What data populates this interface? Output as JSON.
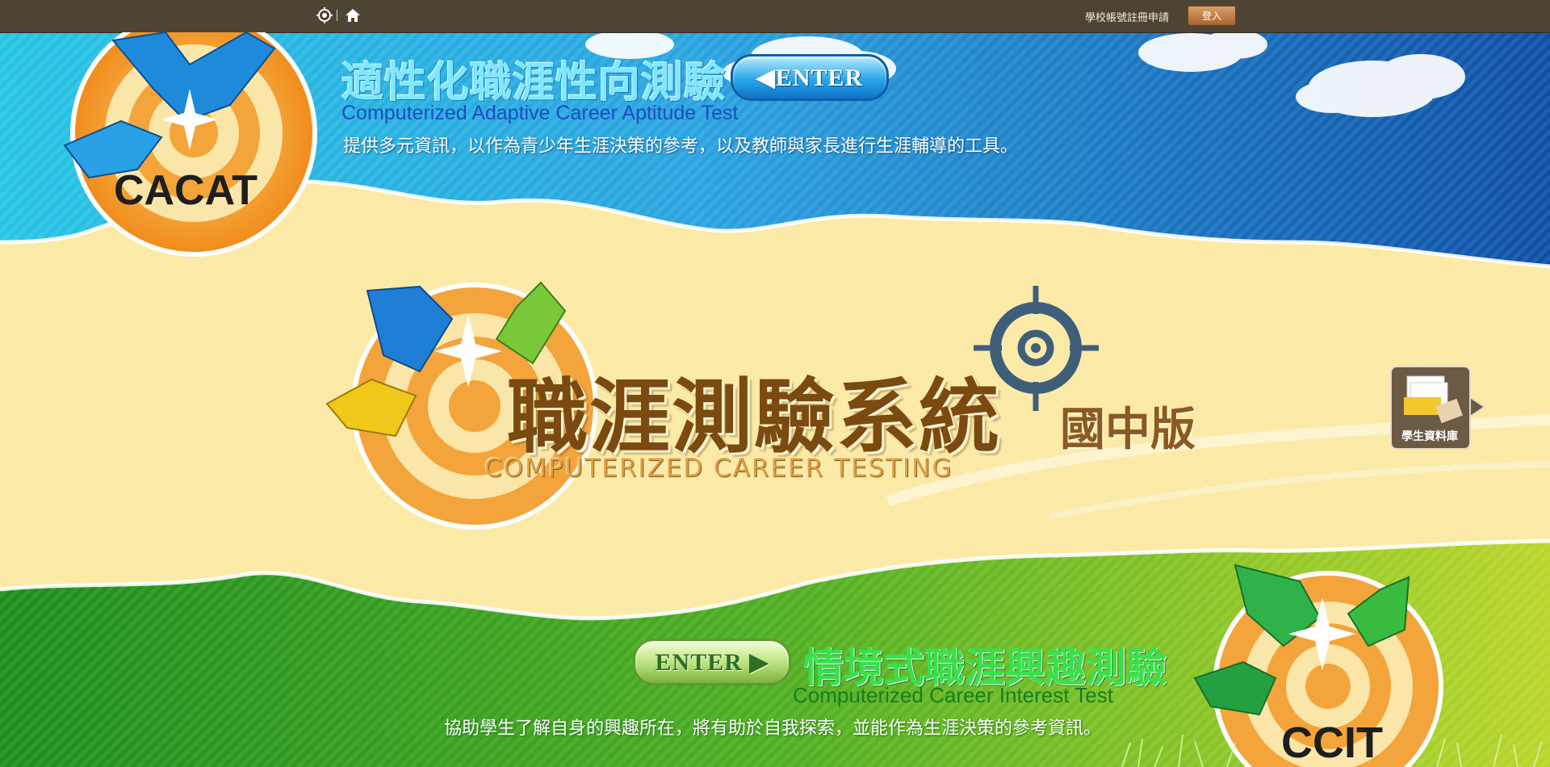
{
  "topbar": {
    "sitemap_icon": "target-icon",
    "home_icon": "home-icon",
    "register_link": "學校帳號註冊申請",
    "login_button": "登入"
  },
  "cacat": {
    "logo_text": "CACAT",
    "title": "適性化職涯性向測驗",
    "enter_label": "◀ENTER",
    "subtitle_en": "Computerized Adaptive Career Aptitude Test",
    "description": "提供多元資訊，以作為青少年生涯決策的參考，以及教師與家長進行生涯輔導的工具。"
  },
  "main": {
    "title": "職涯測驗系統",
    "edition": "國中版",
    "subtitle_en": "COMPUTERIZED CAREER TESTING"
  },
  "student_db": {
    "label": "學生資料庫"
  },
  "ccit": {
    "logo_text": "CCIT",
    "title": "情境式職涯興趣測驗",
    "enter_label": "ENTER ▶",
    "subtitle_en": "Computerized Career Interest Test",
    "description": "協助學生了解自身的興趣所在，將有助於自我探索，並能作為生涯決策的參考資訊。"
  },
  "colors": {
    "topbar": "#4d4434",
    "sky": "#2a8fd4",
    "paper": "#fbe9a4",
    "grass": "#3a9a1e",
    "brown_title": "#7a4a10"
  }
}
